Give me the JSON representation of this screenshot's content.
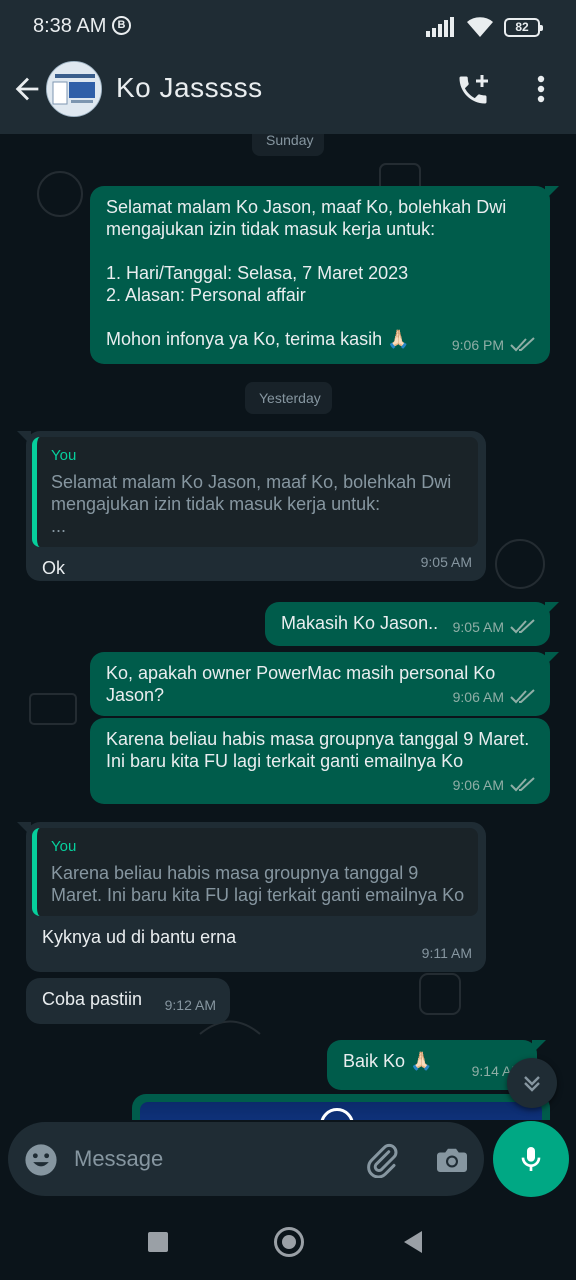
{
  "status_bar": {
    "time": "8:38 AM",
    "b_indicator": "B",
    "battery": "82",
    "icons": [
      "signal-icon",
      "wifi-icon",
      "battery-icon"
    ]
  },
  "header": {
    "contact_name": "Ko Jasssss",
    "icons": [
      "back-arrow-icon",
      "add-call-icon",
      "more-vert-icon"
    ]
  },
  "chat": {
    "date_sunday": "Sunday",
    "date_yesterday": "Yesterday",
    "messages": [
      {
        "direction": "out",
        "text": "Selamat malam Ko Jason, maaf Ko, bolehkah Dwi mengajukan izin tidak masuk kerja untuk:\n\n1. Hari/Tanggal: Selasa, 7 Maret 2023\n2. Alasan: Personal affair\n\nMohon infonya ya Ko, terima kasih 🙏🏻",
        "time": "9:06 PM"
      },
      {
        "direction": "in",
        "quote_author": "You",
        "quote_text": "Selamat malam Ko Jason, maaf Ko, bolehkah Dwi mengajukan izin tidak masuk kerja untuk:\n...",
        "text": "Ok",
        "time": "9:05 AM"
      },
      {
        "direction": "out",
        "text": "Makasih Ko Jason..",
        "time": "9:05 AM"
      },
      {
        "direction": "out",
        "text": "Ko, apakah owner PowerMac masih personal Ko Jason?",
        "time": "9:06 AM"
      },
      {
        "direction": "out",
        "text": "Karena beliau habis masa groupnya tanggal 9 Maret. Ini baru kita FU lagi terkait ganti emailnya Ko",
        "time": "9:06 AM"
      },
      {
        "direction": "in",
        "quote_author": "You",
        "quote_text": "Karena beliau habis masa groupnya tanggal 9 Maret. Ini baru kita FU lagi terkait ganti emailnya Ko",
        "text": "Kyknya ud di bantu erna",
        "time": "9:11 AM"
      },
      {
        "direction": "in",
        "text": "Coba pastiin",
        "time": "9:12 AM"
      },
      {
        "direction": "out",
        "text": "Baik Ko 🙏🏻",
        "time": "9:14 AM"
      }
    ]
  },
  "composer": {
    "placeholder": "Message",
    "icons": [
      "emoji-icon",
      "attach-icon",
      "camera-icon",
      "mic-icon"
    ]
  },
  "colors": {
    "outgoing_bubble": "#005c4b",
    "incoming_bubble": "#1f2c34",
    "accent": "#00a884",
    "quote_accent": "#06cf9c",
    "background": "#0b141a"
  }
}
